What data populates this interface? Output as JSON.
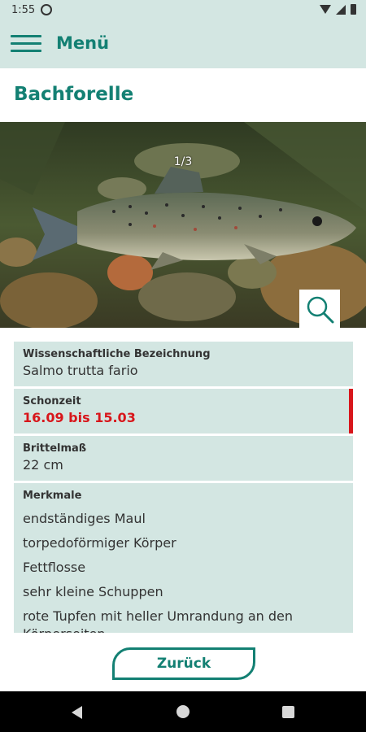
{
  "status_bar": {
    "time": "1:55"
  },
  "app_bar": {
    "menu_label": "Menü"
  },
  "page": {
    "title": "Bachforelle"
  },
  "gallery": {
    "counter": "1/3"
  },
  "details": {
    "scientific_label": "Wissenschaftliche Bezeichnung",
    "scientific_value": "Salmo trutta fario",
    "closed_season_label": "Schonzeit",
    "closed_season_value": "16.09 bis 15.03",
    "min_size_label": "Brittelmaß",
    "min_size_value": "22 cm",
    "features_label": "Merkmale",
    "features": [
      "endständiges Maul",
      "torpedoförmiger Körper",
      "Fettflosse",
      "sehr kleine Schuppen",
      "rote Tupfen mit heller Umrandung an den Körperseiten"
    ]
  },
  "footer": {
    "back_label": "Zurück"
  },
  "colors": {
    "accent": "#138073",
    "panel": "#d3e6e2",
    "alert": "#d8161b"
  },
  "icons": [
    "notification-icon",
    "wifi-icon",
    "signal-icon",
    "battery-icon",
    "hamburger-menu-icon",
    "magnifier-icon",
    "nav-back-icon",
    "nav-home-icon",
    "nav-recent-icon"
  ]
}
